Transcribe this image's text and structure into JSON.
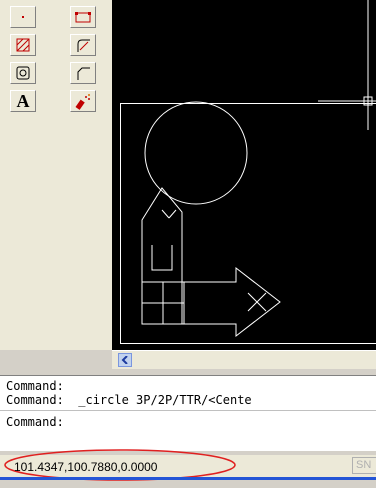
{
  "toolbar": {
    "buttons": [
      {
        "icon": "point-icon"
      },
      {
        "icon": "rectangle-icon"
      },
      {
        "icon": "hatch-icon"
      },
      {
        "icon": "fillet-icon"
      },
      {
        "icon": "region-icon"
      },
      {
        "icon": "chamfer-icon"
      },
      {
        "icon": "text-icon",
        "label": "A"
      },
      {
        "icon": "explode-icon"
      }
    ]
  },
  "command": {
    "line1": "Command:",
    "line2": "Command:  _circle 3P/2P/TTR/<Cente",
    "line3": "Command:"
  },
  "status": {
    "coordinates": "101.4347,100.7880,0.0000",
    "snap_label": "SN",
    "highlight_color": "#e02020"
  }
}
